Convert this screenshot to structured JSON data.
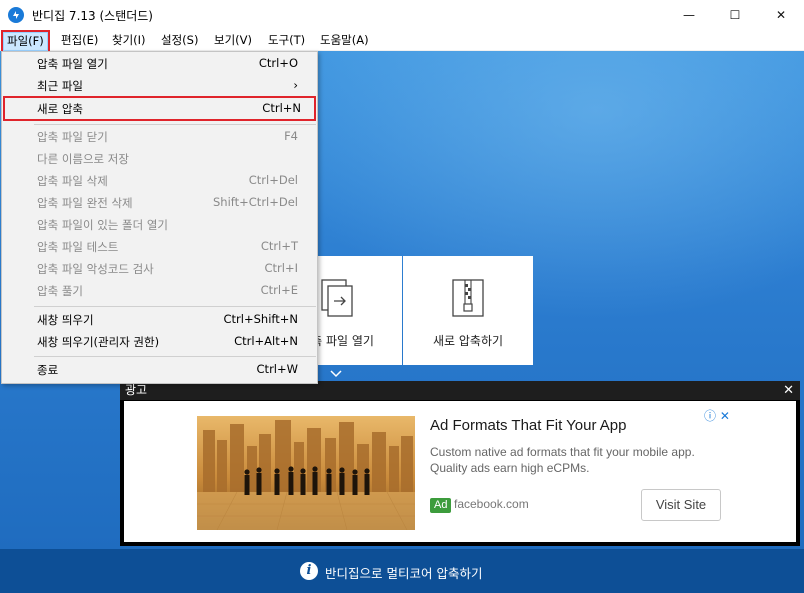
{
  "window": {
    "title": "반디집 7.13 (스탠더드)",
    "minimize_glyph": "—",
    "maximize_glyph": "☐",
    "close_glyph": "✕"
  },
  "menubar": {
    "items": [
      {
        "label": "파일(F)"
      },
      {
        "label": "편집(E)"
      },
      {
        "label": "찾기(I)"
      },
      {
        "label": "설정(S)"
      },
      {
        "label": "보기(V)"
      },
      {
        "label": "도구(T)"
      },
      {
        "label": "도움말(A)"
      }
    ]
  },
  "file_menu": {
    "items": [
      {
        "label": "압축 파일 열기",
        "shortcut": "Ctrl+O",
        "enabled": true
      },
      {
        "label": "최근 파일",
        "shortcut": "›",
        "enabled": true
      },
      {
        "label": "새로 압축",
        "shortcut": "Ctrl+N",
        "enabled": true
      },
      {
        "label": "압축 파일 닫기",
        "shortcut": "F4",
        "enabled": false
      },
      {
        "label": "다른 이름으로 저장",
        "shortcut": "",
        "enabled": false
      },
      {
        "label": "압축 파일 삭제",
        "shortcut": "Ctrl+Del",
        "enabled": false
      },
      {
        "label": "압축 파일 완전 삭제",
        "shortcut": "Shift+Ctrl+Del",
        "enabled": false
      },
      {
        "label": "압축 파일이 있는 폴더 열기",
        "shortcut": "",
        "enabled": false
      },
      {
        "label": "압축 파일 테스트",
        "shortcut": "Ctrl+T",
        "enabled": false
      },
      {
        "label": "압축 파일 악성코드 검사",
        "shortcut": "Ctrl+I",
        "enabled": false
      },
      {
        "label": "압축 풀기",
        "shortcut": "Ctrl+E",
        "enabled": false
      },
      {
        "label": "새창 띄우기",
        "shortcut": "Ctrl+Shift+N",
        "enabled": true
      },
      {
        "label": "새창 띄우기(관리자 권한)",
        "shortcut": "Ctrl+Alt+N",
        "enabled": true
      },
      {
        "label": "종료",
        "shortcut": "Ctrl+W",
        "enabled": true
      }
    ]
  },
  "tiles": {
    "open_label": "압축 파일 열기",
    "new_label": "새로 압축하기"
  },
  "ad": {
    "header_label": "광고",
    "close_glyph": "✕",
    "choices_glyph": "ⓘ ✕",
    "title": "Ad Formats That Fit Your App",
    "description": "Custom native ad formats that fit your mobile app. Quality ads earn high eCPMs.",
    "badge": "Ad",
    "domain": "facebook.com",
    "cta": "Visit Site"
  },
  "status": {
    "icon_glyph": "i",
    "text": "반디집으로 멀티코어 압축하기"
  },
  "colors": {
    "accent": "#1a7ad8",
    "highlight_red": "#e0242b",
    "status_bar": "#0d4f96",
    "ad_badge": "#3c9c3c"
  }
}
